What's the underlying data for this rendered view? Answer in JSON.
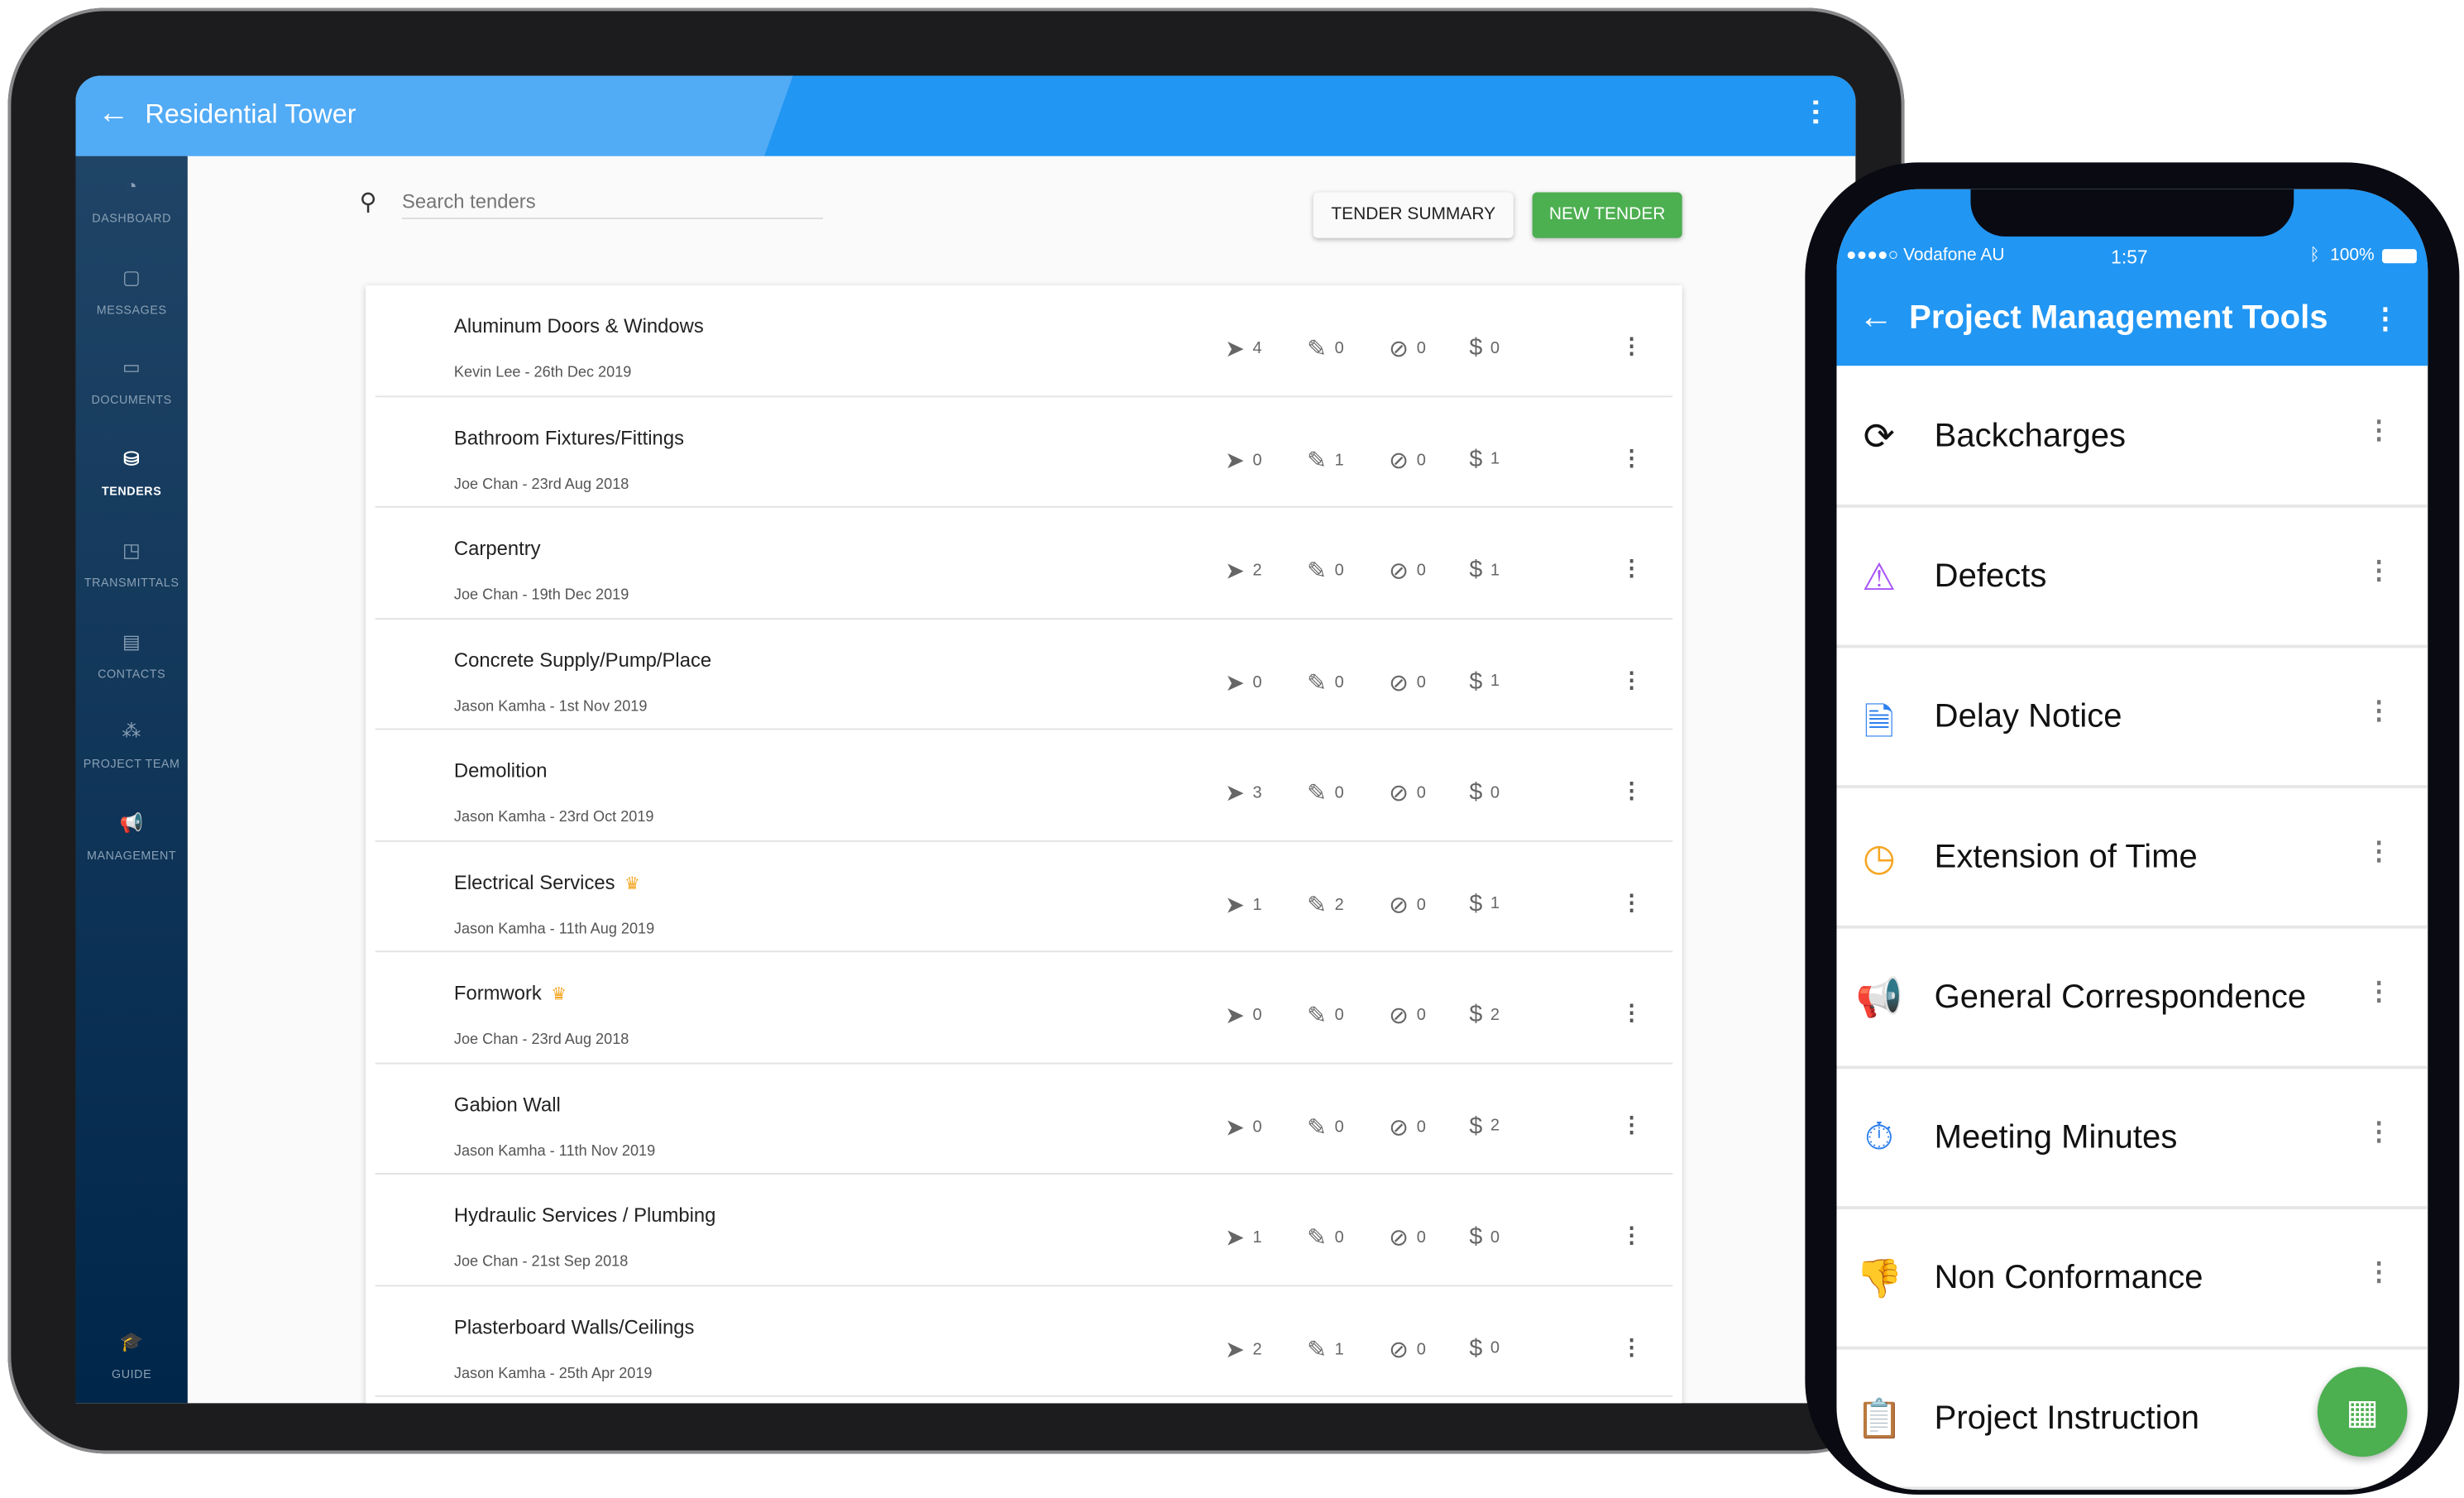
{
  "tablet": {
    "header": {
      "title": "Residential Tower",
      "back_icon": "arrow-left-icon",
      "more_icon": "more-vertical-icon"
    },
    "sidebar": {
      "items": [
        {
          "label": "DASHBOARD",
          "icon": "gauge-icon",
          "active": false
        },
        {
          "label": "MESSAGES",
          "icon": "chat-icon",
          "active": false
        },
        {
          "label": "DOCUMENTS",
          "icon": "folder-icon",
          "active": false
        },
        {
          "label": "TENDERS",
          "icon": "tender-box-icon",
          "active": true
        },
        {
          "label": "TRANSMITTALS",
          "icon": "transmittal-icon",
          "active": false
        },
        {
          "label": "CONTACTS",
          "icon": "contacts-book-icon",
          "active": false
        },
        {
          "label": "PROJECT TEAM",
          "icon": "team-icon",
          "active": false
        },
        {
          "label": "MANAGEMENT",
          "icon": "megaphone-icon",
          "active": false
        }
      ],
      "guide": {
        "label": "GUIDE",
        "icon": "graduation-cap-icon"
      }
    },
    "search": {
      "placeholder": "Search tenders",
      "value": ""
    },
    "buttons": {
      "tender_summary": "TENDER SUMMARY",
      "new_tender": "NEW TENDER"
    },
    "colors": {
      "header": "#2196f3",
      "sidebar": "#00264a",
      "new_tender": "#4caf50",
      "crown": "#f5a623"
    },
    "tenders": [
      {
        "name": "Aluminum Doors & Windows",
        "meta": "Kevin Lee - 26th Dec 2019",
        "sent": "4",
        "edited": "0",
        "declined": "0",
        "priced": "0",
        "crown": false
      },
      {
        "name": "Bathroom Fixtures/Fittings",
        "meta": "Joe Chan - 23rd Aug 2018",
        "sent": "0",
        "edited": "1",
        "declined": "0",
        "priced": "1",
        "crown": false
      },
      {
        "name": "Carpentry",
        "meta": "Joe Chan - 19th Dec 2019",
        "sent": "2",
        "edited": "0",
        "declined": "0",
        "priced": "1",
        "crown": false
      },
      {
        "name": "Concrete Supply/Pump/Place",
        "meta": "Jason Kamha - 1st Nov 2019",
        "sent": "0",
        "edited": "0",
        "declined": "0",
        "priced": "1",
        "crown": false
      },
      {
        "name": "Demolition",
        "meta": "Jason Kamha - 23rd Oct 2019",
        "sent": "3",
        "edited": "0",
        "declined": "0",
        "priced": "0",
        "crown": false
      },
      {
        "name": "Electrical Services",
        "meta": "Jason Kamha - 11th Aug 2019",
        "sent": "1",
        "edited": "2",
        "declined": "0",
        "priced": "1",
        "crown": true
      },
      {
        "name": "Formwork",
        "meta": "Joe Chan - 23rd Aug 2018",
        "sent": "0",
        "edited": "0",
        "declined": "0",
        "priced": "2",
        "crown": true
      },
      {
        "name": "Gabion Wall",
        "meta": "Jason Kamha - 11th Nov 2019",
        "sent": "0",
        "edited": "0",
        "declined": "0",
        "priced": "2",
        "crown": false
      },
      {
        "name": "Hydraulic Services / Plumbing",
        "meta": "Joe Chan - 21st Sep 2018",
        "sent": "1",
        "edited": "0",
        "declined": "0",
        "priced": "0",
        "crown": false
      },
      {
        "name": "Plasterboard Walls/Ceilings",
        "meta": "Jason Kamha - 25th Apr 2019",
        "sent": "2",
        "edited": "1",
        "declined": "0",
        "priced": "0",
        "crown": false
      }
    ]
  },
  "phone": {
    "status": {
      "carrier": "●●●●○ Vodafone AU",
      "time": "1:57",
      "battery": "100%"
    },
    "header": {
      "title": "Project Management Tools"
    },
    "tools": [
      {
        "label": "Backcharges",
        "icon": "dollar-cycle-icon",
        "color": "#111111"
      },
      {
        "label": "Defects",
        "icon": "warning-triangle-icon",
        "color": "#a855f7"
      },
      {
        "label": "Delay Notice",
        "icon": "document-clock-icon",
        "color": "#2f80ed"
      },
      {
        "label": "Extension of Time",
        "icon": "clock-history-icon",
        "color": "#f5a623"
      },
      {
        "label": "General Correspondence",
        "icon": "megaphone-icon",
        "color": "#f2622e"
      },
      {
        "label": "Meeting Minutes",
        "icon": "stopwatch-icon",
        "color": "#2f80ed"
      },
      {
        "label": "Non Conformance",
        "icon": "thumbs-down-icon",
        "color": "#f5b50a"
      },
      {
        "label": "Project Instruction",
        "icon": "clipboard-icon",
        "color": "#13a884"
      }
    ],
    "fab_icon": "grid-icon"
  }
}
